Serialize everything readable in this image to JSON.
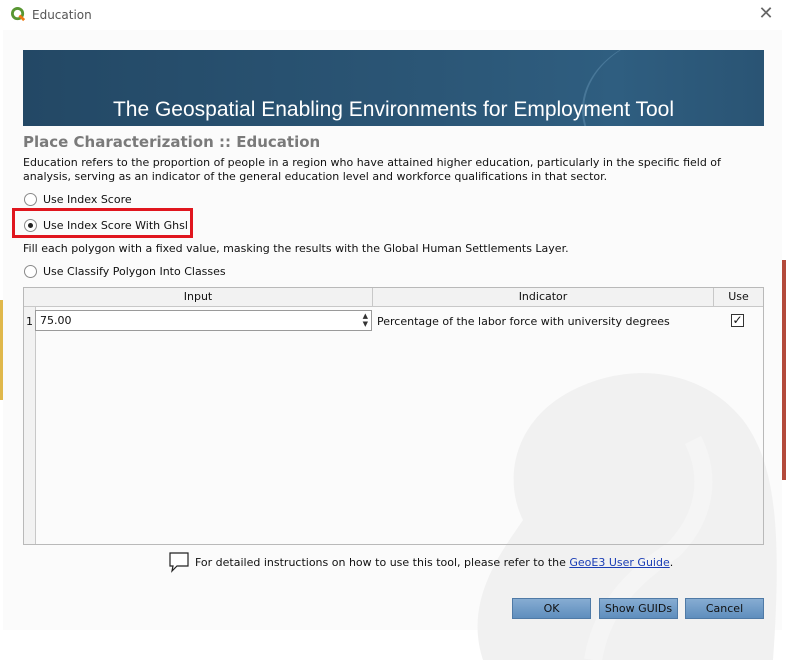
{
  "window": {
    "title": "Education"
  },
  "banner": {
    "title": "The Geospatial Enabling Environments for Employment Tool"
  },
  "section": {
    "title": "Place Characterization :: Education",
    "description": "Education refers to the proportion of people in a region who have attained higher education, particularly in the specific field of analysis, serving as an indicator of the general education level and workforce qualifications in that sector."
  },
  "options": [
    {
      "label": "Use Index Score",
      "selected": false
    },
    {
      "label": "Use Index Score With Ghsl",
      "selected": true
    },
    {
      "label": "Use Classify Polygon Into Classes",
      "selected": false
    }
  ],
  "fill_note": "Fill each polygon with a fixed value, masking the results with the Global Human Settlements Layer.",
  "table": {
    "headers": [
      "Input",
      "Indicator",
      "Use"
    ],
    "rows": [
      {
        "row_number": "1",
        "input": "75.00",
        "indicator": "Percentage of the labor force with university degrees",
        "use": true
      }
    ]
  },
  "guide": {
    "prefix": "For detailed instructions on how to use this tool, please refer to the",
    "link": "GeoE3 User Guide",
    "suffix": "."
  },
  "buttons": {
    "ok": "OK",
    "show_guids": "Show GUIDs",
    "cancel": "Cancel"
  },
  "colors": {
    "highlight": "#e0161e",
    "banner": "#2b5676",
    "link": "#1a3db5",
    "button": "#6f99c4"
  }
}
